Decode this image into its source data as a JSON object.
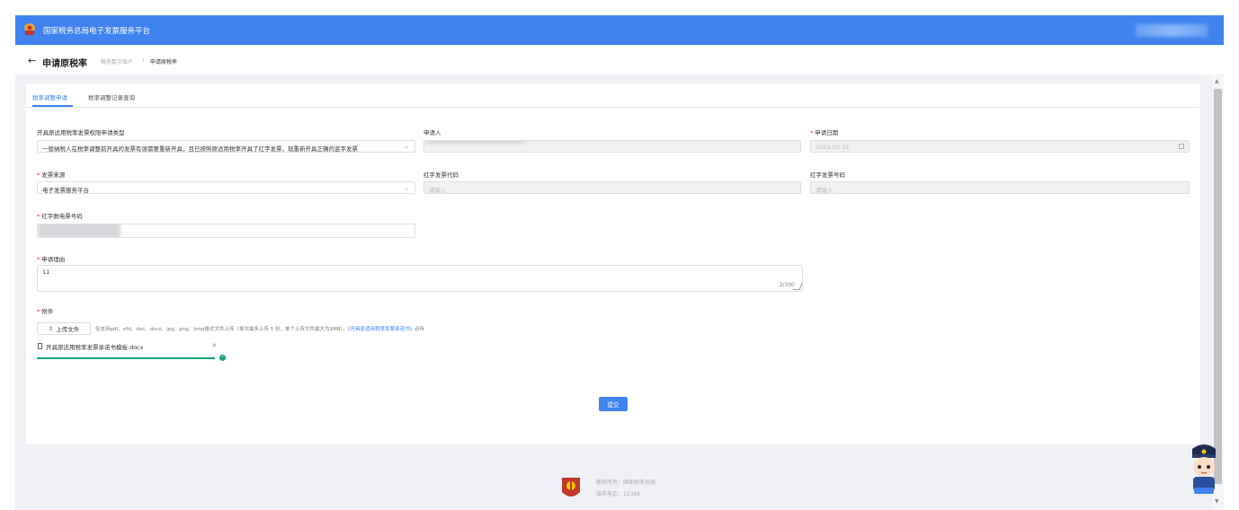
{
  "app": {
    "title": "国家税务总局电子发票服务平台"
  },
  "breadcrumb": {
    "page_title": "申请原税率",
    "items": [
      "税务数字账户",
      "申请原税率"
    ],
    "separator": "›"
  },
  "tabs": [
    {
      "label": "税率调整申请",
      "active": true
    },
    {
      "label": "税率调整记录查询",
      "active": false
    }
  ],
  "form": {
    "apply_type": {
      "label": "开具原适用税率发票权限申请类型",
      "value": "一般纳税人在税率调整前开具的发票有误需要重新开具，且已按照原适用税率开具了红字发票，现重新开具正确的蓝字发票"
    },
    "applicant": {
      "label": "申请人"
    },
    "apply_date": {
      "label": "申请日期",
      "value": "2023-03-31"
    },
    "invoice_source": {
      "label": "发票来源",
      "value": "电子发票服务平台"
    },
    "red_invoice_code": {
      "label": "红字发票代码",
      "placeholder": "请输入"
    },
    "red_invoice_number": {
      "label": "红字发票号码",
      "placeholder": "请输入"
    },
    "red_digital_invoice_number": {
      "label": "红字数电票号码"
    },
    "reason": {
      "label": "申请理由",
      "value": "11",
      "counter": "2/300"
    },
    "attachment": {
      "label": "附件",
      "upload_button": "上传文件",
      "hint": "仅支持pdf、ofd、doc、docx、jpg、png、bmp格式文件上传（单次最多上传 5 份，单个上传文件最大为1MB），",
      "hint_link": "《开具原适用税率发票承诺书》",
      "hint_suffix": "必传",
      "files": [
        {
          "name": "开具原适用税率发票承诺书模板.docx",
          "progress": 1.0,
          "status": "success"
        }
      ]
    },
    "submit_label": "提交"
  },
  "footer": {
    "copyright": "版权所有：国家税务总局",
    "hotline": "服务电话：12366"
  },
  "colors": {
    "brand_blue": "#3f82f0",
    "success_green": "#13a46d",
    "required_red": "#f5222d"
  }
}
